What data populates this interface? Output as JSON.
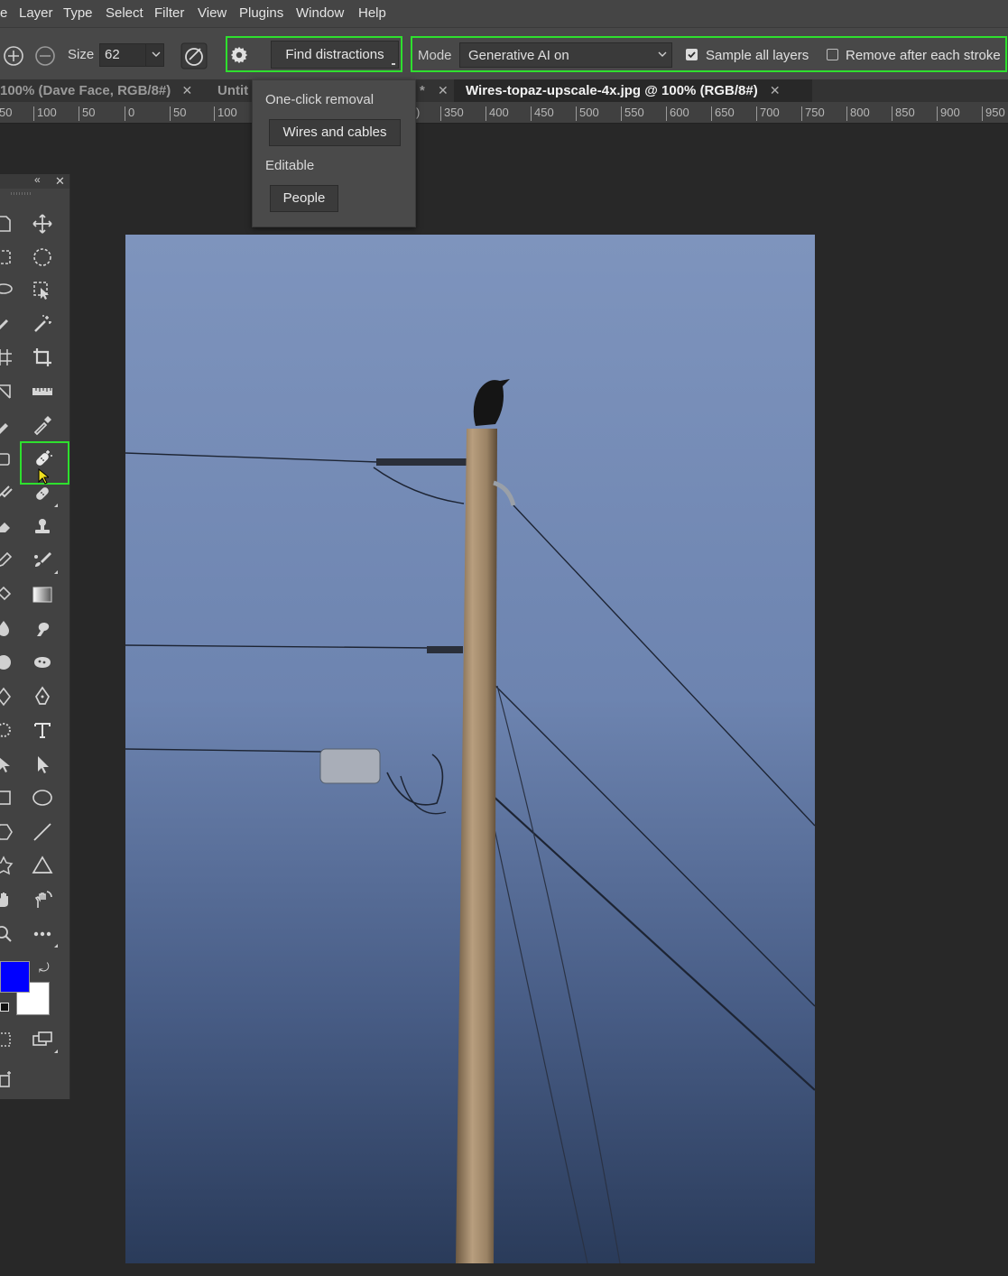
{
  "menu": [
    "e",
    "Layer",
    "Type",
    "Select",
    "Filter",
    "View",
    "Plugins",
    "Window",
    "Help"
  ],
  "options": {
    "size_label": "Size",
    "size_value": "62",
    "find_distractions": "Find distractions",
    "mode_label": "Mode",
    "mode_value": "Generative AI on",
    "sample_all_layers": "Sample all layers",
    "sample_all_layers_checked": true,
    "remove_after_stroke": "Remove after each stroke",
    "remove_after_stroke_checked": false
  },
  "tabs": {
    "tab1": "100% (Dave Face, RGB/8#)",
    "tab2": "Untit",
    "tab3": "*",
    "tab4": "Wires-topaz-upscale-4x.jpg @ 100% (RGB/8#)"
  },
  "ruler": [
    "50",
    "100",
    "50",
    "0",
    "50",
    "100",
    ")",
    "350",
    "400",
    "450",
    "500",
    "550",
    "600",
    "650",
    "700",
    "750",
    "800",
    "850",
    "900",
    "950"
  ],
  "dropdown": {
    "section1": "One-click removal",
    "wires_button": "Wires and cables",
    "section2": "Editable",
    "people_button": "People"
  },
  "colors": {
    "highlight": "#2ee02e",
    "foreground": "#0000ff",
    "background": "#ffffff",
    "sky_top": "#8096bf",
    "sky_bottom": "#2b3d5c"
  },
  "toolbar_icons_right": [
    "move-icon",
    "elliptical-marquee-icon",
    "object-selection-icon",
    "magic-wand-icon",
    "crop-icon",
    "ruler-icon",
    "eyedropper-icon",
    "remove-tool-icon",
    "healing-brush-icon",
    "clone-stamp-icon",
    "mixer-brush-icon",
    "gradient-icon",
    "smudge-icon",
    "sponge-icon",
    "pen-icon",
    "type-icon",
    "direct-selection-icon",
    "ellipse-icon",
    "line-icon",
    "triangle-icon",
    "rotate-view-icon",
    "more-tools-icon"
  ]
}
